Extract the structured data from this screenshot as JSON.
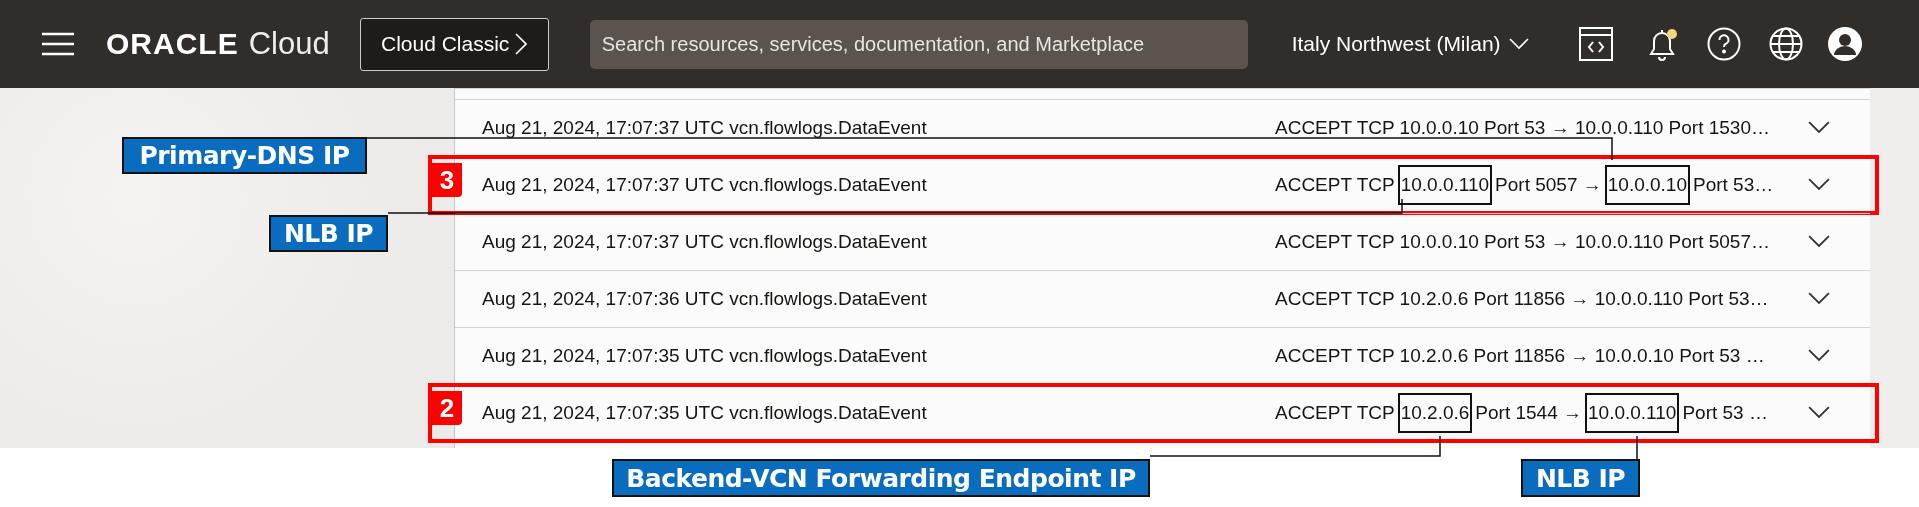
{
  "header": {
    "logo": {
      "brand": "ORACLE",
      "product": "Cloud"
    },
    "classic_button": "Cloud Classic",
    "search": {
      "placeholder": "Search resources, services, documentation, and Marketplace"
    },
    "region": "Italy Northwest (Milan)",
    "notifications": {
      "unread": true
    }
  },
  "log_rows": [
    {
      "event": "Aug 21, 2024, 17:07:37 UTC vcn.flowlogs.DataEvent",
      "message": [
        {
          "text": "ACCEPT TCP 10.0.0.10 Port 53 → 10.0.0.110 Port 1530…",
          "boxed": false
        }
      ],
      "highlighted": false
    },
    {
      "event": "Aug 21, 2024, 17:07:37 UTC vcn.flowlogs.DataEvent",
      "message": [
        {
          "text": "ACCEPT TCP",
          "boxed": false
        },
        {
          "text": "10.0.0.110",
          "boxed": true
        },
        {
          "text": "Port 5057 →",
          "boxed": false
        },
        {
          "text": "10.0.0.10",
          "boxed": true
        },
        {
          "text": "Port 53…",
          "boxed": false
        }
      ],
      "highlighted": true,
      "step": "3"
    },
    {
      "event": "Aug 21, 2024, 17:07:37 UTC vcn.flowlogs.DataEvent",
      "message": [
        {
          "text": "ACCEPT TCP 10.0.0.10 Port 53 → 10.0.0.110 Port 5057…",
          "boxed": false
        }
      ],
      "highlighted": false
    },
    {
      "event": "Aug 21, 2024, 17:07:36 UTC vcn.flowlogs.DataEvent",
      "message": [
        {
          "text": "ACCEPT TCP 10.2.0.6 Port 11856 → 10.0.0.110 Port 53…",
          "boxed": false
        }
      ],
      "highlighted": false
    },
    {
      "event": "Aug 21, 2024, 17:07:35 UTC vcn.flowlogs.DataEvent",
      "message": [
        {
          "text": "ACCEPT TCP 10.2.0.6 Port 11856 → 10.0.0.10 Port 53 …",
          "boxed": false
        }
      ],
      "highlighted": false
    },
    {
      "event": "Aug 21, 2024, 17:07:35 UTC vcn.flowlogs.DataEvent",
      "message": [
        {
          "text": "ACCEPT TCP",
          "boxed": false
        },
        {
          "text": "10.2.0.6",
          "boxed": true
        },
        {
          "text": "Port 1544 →",
          "boxed": false
        },
        {
          "text": "10.0.0.110",
          "boxed": true
        },
        {
          "text": "Port 53 …",
          "boxed": false
        }
      ],
      "highlighted": true,
      "step": "2"
    }
  ],
  "callouts": [
    {
      "label": "Primary-DNS IP"
    },
    {
      "label": "NLB IP"
    },
    {
      "label": "Backend-VCN Forwarding Endpoint IP"
    },
    {
      "label": "NLB IP"
    }
  ]
}
